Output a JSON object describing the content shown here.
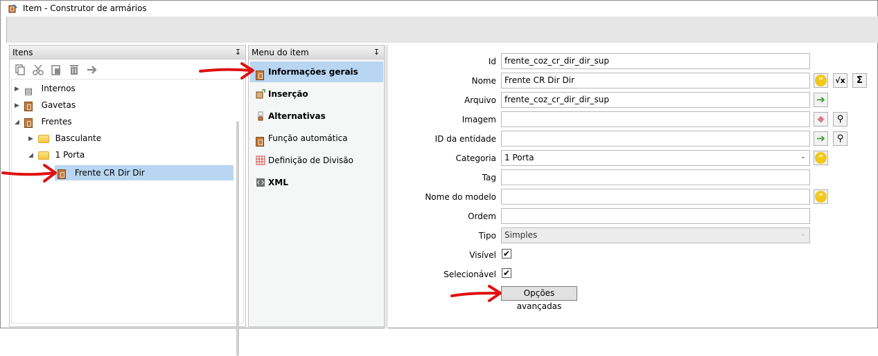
{
  "window": {
    "title": "Item - Construtor de armários"
  },
  "left_pane": {
    "header": "Itens",
    "pin": "↧",
    "toolbar": [
      "copy-icon",
      "cut-icon",
      "paste-icon",
      "delete-icon",
      "move-icon"
    ],
    "tree": [
      {
        "label": "Internos",
        "icon": "list-icon",
        "toggle": "▶"
      },
      {
        "label": "Gavetas",
        "icon": "drawer-icon",
        "toggle": "▶"
      },
      {
        "label": "Frentes",
        "icon": "drawer-icon",
        "toggle": "◢"
      },
      {
        "label": "Basculante",
        "icon": "folder-icon",
        "toggle": "▶"
      },
      {
        "label": "1 Porta",
        "icon": "folder-icon",
        "toggle": "◢"
      },
      {
        "label": "Frente CR Dir Dir",
        "icon": "door-icon",
        "selected": true
      }
    ]
  },
  "mid_pane": {
    "header": "Menu do item",
    "pin": "↧",
    "items": [
      {
        "label": "Informações gerais",
        "bold": true,
        "selected": true
      },
      {
        "label": "Inserção",
        "bold": true
      },
      {
        "label": "Alternativas",
        "bold": true
      },
      {
        "label": "Função automática",
        "bold": false
      },
      {
        "label": "Definição de Divisão",
        "bold": false
      },
      {
        "label": "XML",
        "bold": true
      }
    ]
  },
  "form": {
    "id_label": "Id",
    "id_value": "frente_coz_cr_dir_dir_sup",
    "nome_label": "Nome",
    "nome_value": "Frente CR Dir Dir",
    "arquivo_label": "Arquivo",
    "arquivo_value": "frente_coz_cr_dir_dir_sup",
    "imagem_label": "Imagem",
    "imagem_value": "",
    "entidade_label": "ID da entidade",
    "entidade_value": "",
    "categoria_label": "Categoria",
    "categoria_value": "1 Porta",
    "tag_label": "Tag",
    "tag_value": "",
    "modelo_label": "Nome do modelo",
    "modelo_value": "",
    "ordem_label": "Ordem",
    "ordem_value": "",
    "tipo_label": "Tipo",
    "tipo_value": "Simples",
    "visivel_label": "Visível",
    "visivel_checked": true,
    "selecionavel_label": "Selecionável",
    "selecionavel_checked": true,
    "advanced_button": "Opções avançadas",
    "check_mark": "✔",
    "quote_glyph": "”",
    "sqrt_glyph": "√x",
    "sigma_glyph": "Σ",
    "arrow_glyph": "➔",
    "magnifier_glyph": "⚲",
    "eraser_glyph": "◆",
    "combo_glyph": "⌄"
  },
  "colors": {
    "selection": "#b8d6f2",
    "annotation_arrow": "#e01010"
  }
}
